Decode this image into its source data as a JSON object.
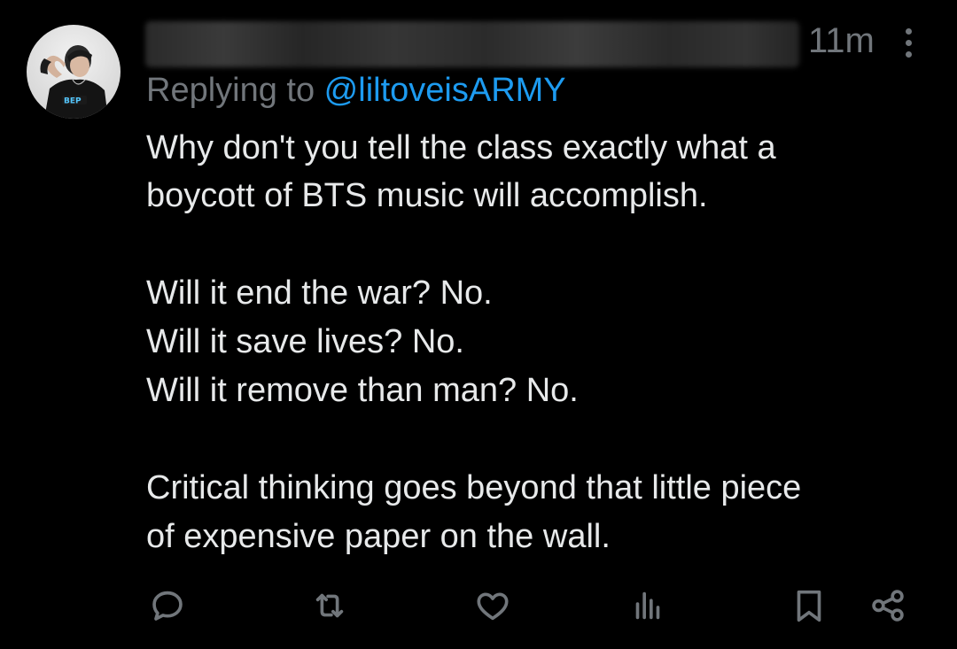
{
  "tweet": {
    "timestamp": "11m",
    "replying_prefix": "Replying to ",
    "replying_handle": "@liltoveisARMY",
    "lines": [
      "Why don't you tell the class exactly what a",
      "boycott of BTS music will accomplish.",
      "Will it end the war? No.",
      "Will it save lives? No.",
      "Will it remove than man? No.",
      "Critical thinking goes beyond that little piece",
      "of expensive paper on the wall."
    ],
    "avatar_shirt_text": "BEP"
  },
  "actions": [
    "reply-icon",
    "retweet-icon",
    "like-icon",
    "views-icon",
    "bookmark-icon",
    "share-icon"
  ],
  "colors": {
    "background": "#000000",
    "text": "#e7e9ea",
    "muted": "#71767b",
    "accent": "#1d9bf0"
  }
}
